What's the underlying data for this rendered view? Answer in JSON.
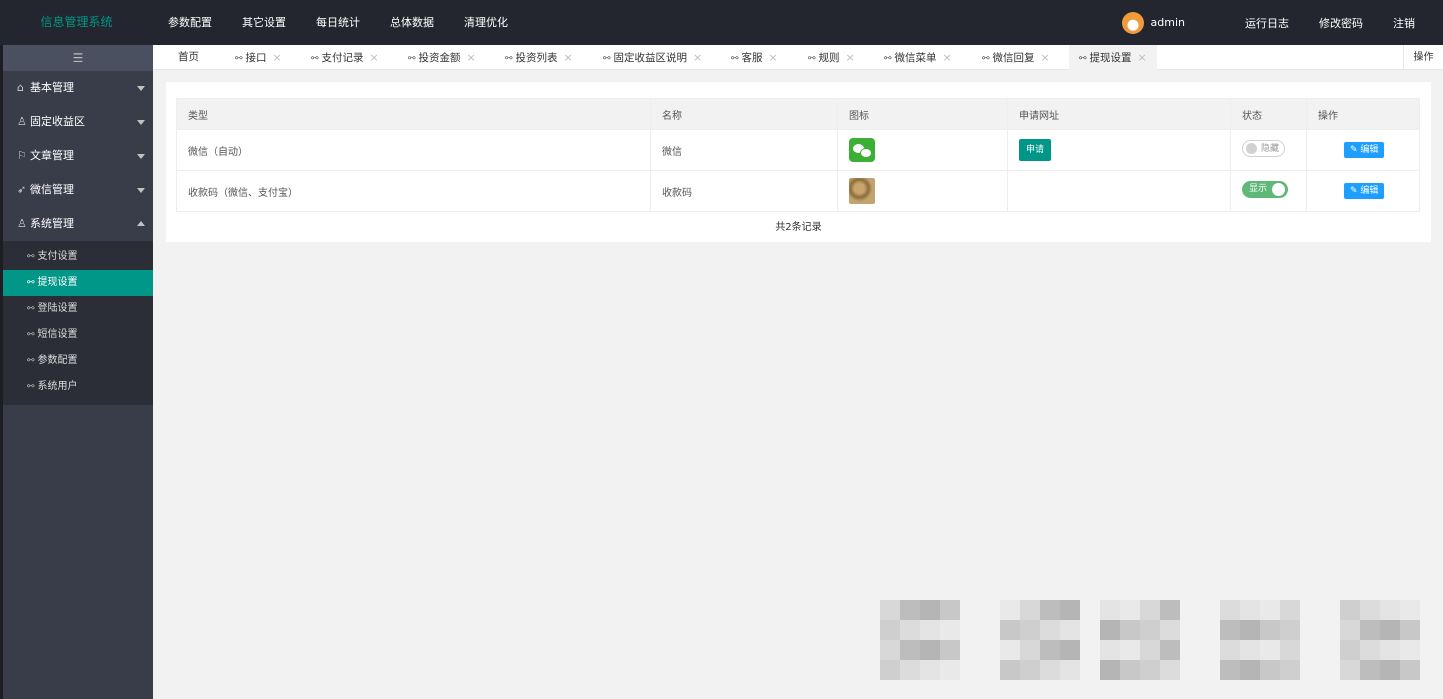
{
  "app": {
    "logo": "信息管理系统"
  },
  "topnav": [
    {
      "label": "参数配置"
    },
    {
      "label": "其它设置"
    },
    {
      "label": "每日统计"
    },
    {
      "label": "总体数据"
    },
    {
      "label": "清理优化"
    }
  ],
  "user": {
    "name": "admin"
  },
  "topright": {
    "log": "运行日志",
    "password": "修改密码",
    "logout": "注销"
  },
  "sidebar": {
    "toggle_icon": "☰",
    "menus": [
      {
        "label": "基本管理",
        "icon": "home-icon",
        "glyph": "⌂"
      },
      {
        "label": "固定收益区",
        "icon": "user-icon",
        "glyph": "♙"
      },
      {
        "label": "文章管理",
        "icon": "flag-icon",
        "glyph": "⚐"
      },
      {
        "label": "微信管理",
        "icon": "send-icon",
        "glyph": "➶"
      },
      {
        "label": "系统管理",
        "icon": "person-icon",
        "glyph": "♙"
      }
    ],
    "submenu": [
      {
        "label": "支付设置"
      },
      {
        "label": "提现设置",
        "active": true
      },
      {
        "label": "登陆设置"
      },
      {
        "label": "短信设置"
      },
      {
        "label": "参数配置"
      },
      {
        "label": "系统用户"
      }
    ]
  },
  "tabs": {
    "home": "首页",
    "items": [
      {
        "label": "接口"
      },
      {
        "label": "支付记录"
      },
      {
        "label": "投资金额"
      },
      {
        "label": "投资列表"
      },
      {
        "label": "固定收益区说明"
      },
      {
        "label": "客服"
      },
      {
        "label": "规则"
      },
      {
        "label": "微信菜单"
      },
      {
        "label": "微信回复"
      },
      {
        "label": "提现设置",
        "active": true
      }
    ],
    "close": "×",
    "link_glyph": "⚯",
    "ops": "操作"
  },
  "table": {
    "headers": [
      "类型",
      "名称",
      "图标",
      "申请网址",
      "状态",
      "操作"
    ],
    "rows": [
      {
        "type": "微信（自动）",
        "name": "微信",
        "icon": "wechat-icon",
        "apply": "申请",
        "status": "隐藏",
        "status_on": false,
        "edit": "编辑"
      },
      {
        "type": "收款码（微信、支付宝）",
        "name": "收款码",
        "icon": "qrcode-image",
        "apply": "",
        "status": "显示",
        "status_on": true,
        "edit": "编辑"
      }
    ],
    "total": "共2条记录"
  },
  "colors": {
    "accent": "#009688",
    "header_bg": "#23262e",
    "sidebar_bg": "#393d49",
    "edit_btn": "#1e9fff",
    "switch_on": "#5fb878"
  }
}
